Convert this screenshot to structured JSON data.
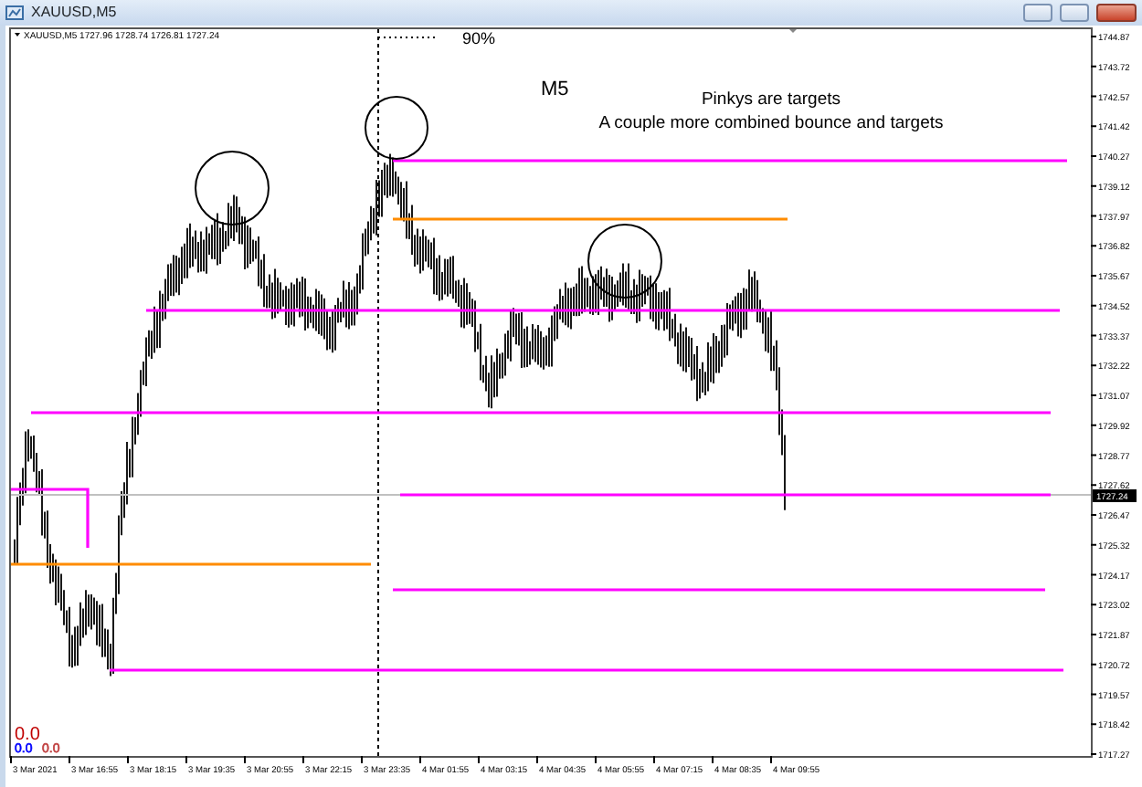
{
  "window": {
    "title": "XAUUSD,M5"
  },
  "chart": {
    "info": "XAUUSD,M5  1727.96 1728.74 1726.81 1727.24",
    "scale": "90%",
    "timeframe_label": "M5",
    "notes": [
      "Pinkys are targets",
      "A couple more combined bounce and targets"
    ],
    "indicator": {
      "main": "0.0",
      "buffers": [
        {
          "value": "0.0",
          "color": "#0000ff"
        },
        {
          "value": "0.0",
          "color": "#c04040"
        }
      ]
    },
    "price_axis": [
      "1744.87",
      "1743.72",
      "1742.57",
      "1741.42",
      "1740.27",
      "1739.12",
      "1737.97",
      "1736.82",
      "1735.67",
      "1734.52",
      "1733.37",
      "1732.22",
      "1731.07",
      "1729.92",
      "1728.77",
      "1727.62",
      "1726.47",
      "1725.32",
      "1724.17",
      "1723.02",
      "1721.87",
      "1720.72",
      "1719.57",
      "1718.42",
      "1717.27"
    ],
    "current_price": "1727.24",
    "time_axis": [
      "3 Mar 2021",
      "3 Mar 16:55",
      "3 Mar 18:15",
      "3 Mar 19:35",
      "3 Mar 20:55",
      "3 Mar 22:15",
      "3 Mar 23:35",
      "4 Mar 01:55",
      "4 Mar 03:15",
      "4 Mar 04:35",
      "4 Mar 05:55",
      "4 Mar 07:15",
      "4 Mar 08:35",
      "4 Mar 09:55"
    ]
  }
}
